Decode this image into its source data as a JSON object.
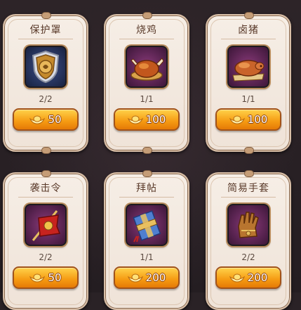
{
  "items": [
    {
      "name": "保护罩",
      "count": "2/2",
      "price": "50",
      "icon": "shield-icon"
    },
    {
      "name": "烧鸡",
      "count": "1/1",
      "price": "100",
      "icon": "roast-chicken-icon"
    },
    {
      "name": "卤猪",
      "count": "1/1",
      "price": "100",
      "icon": "braised-pig-icon"
    },
    {
      "name": "袭击令",
      "count": "2/2",
      "price": "50",
      "icon": "raid-flag-icon"
    },
    {
      "name": "拜帖",
      "count": "1/1",
      "price": "200",
      "icon": "invitation-card-icon"
    },
    {
      "name": "简易手套",
      "count": "2/2",
      "price": "200",
      "icon": "glove-icon"
    }
  ],
  "currency_icon": "gold-ingot-icon",
  "colors": {
    "card_bg": "#f6eee6",
    "button": "#f59a12",
    "background": "#2a2226"
  }
}
